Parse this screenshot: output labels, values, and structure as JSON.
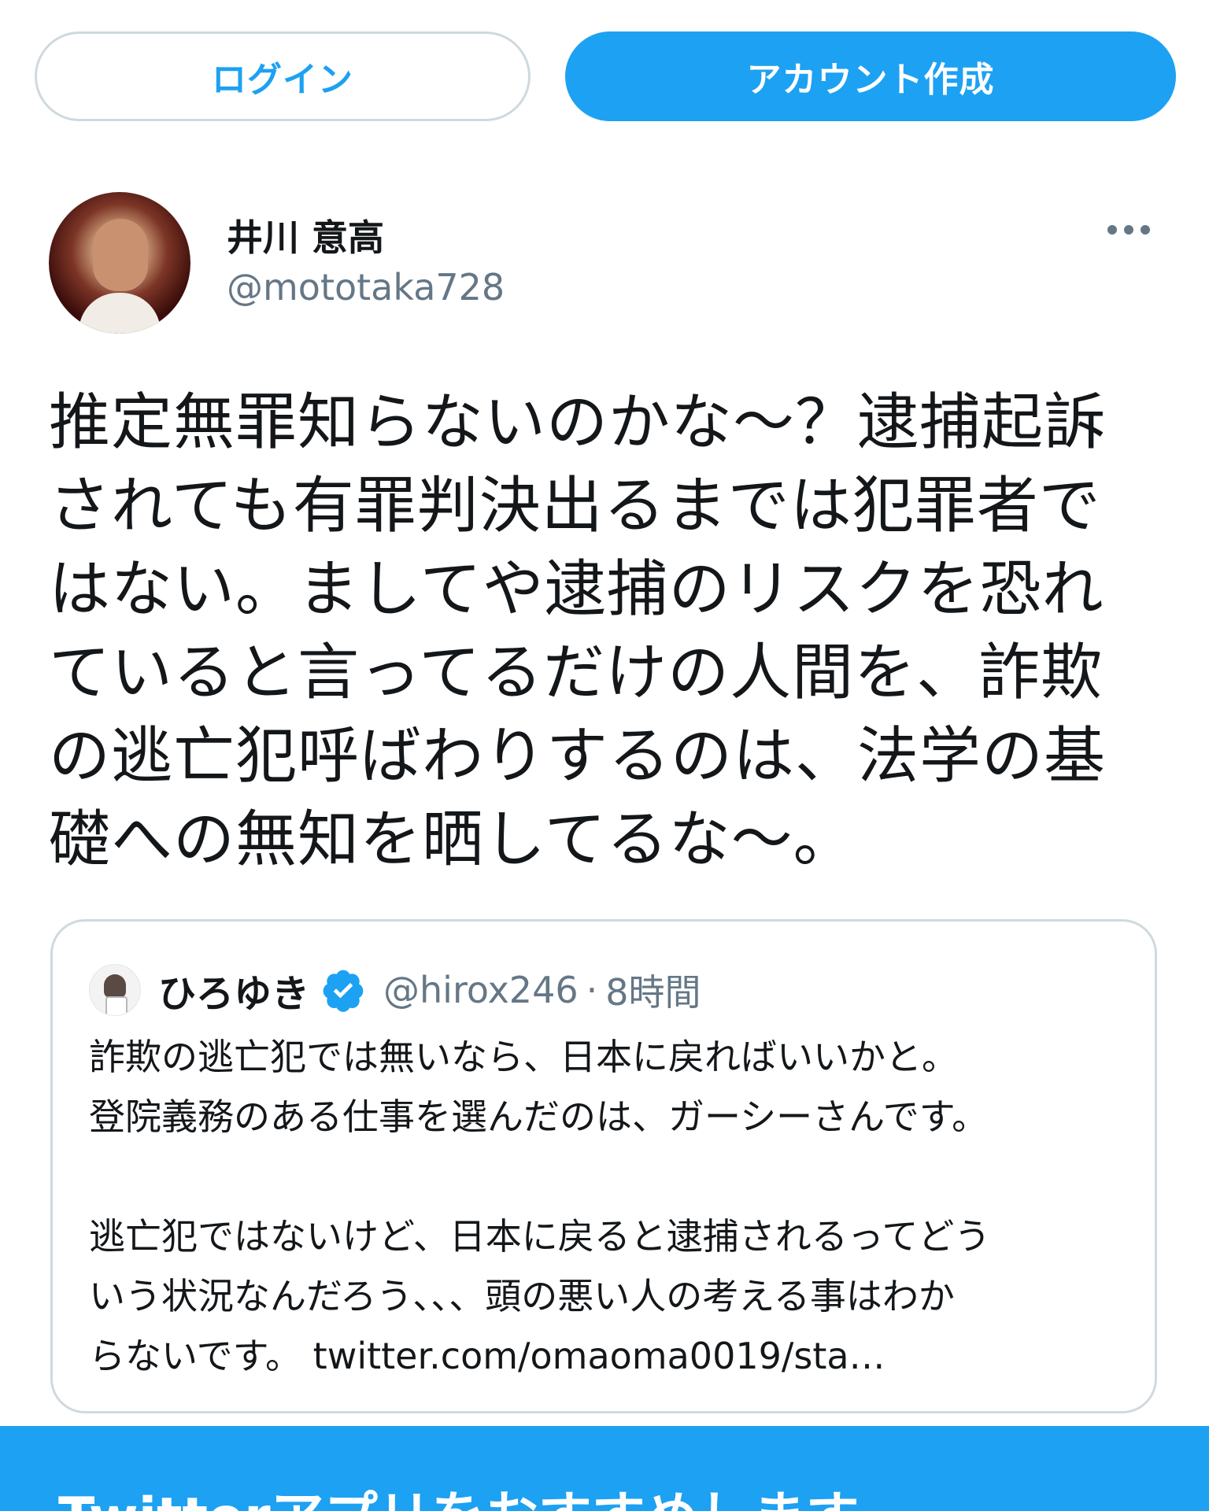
{
  "header": {
    "login_label": "ログイン",
    "signup_label": "アカウント作成"
  },
  "author": {
    "name": "井川 意高",
    "handle": "@mototaka728",
    "more_icon": "more-horizontal-icon"
  },
  "tweet": {
    "text": "推定無罪知らないのかな〜？逮捕起訴\nされても有罪判決出るまでは犯罪者で\nはない。ましてや逮捕のリスクを恐れ\nていると言ってるだけの人間を、詐欺\nの逃亡犯呼ばわりするのは、法学の基\n礎への無知を晒してるな〜。"
  },
  "quoted_tweet": {
    "name": "ひろゆき",
    "verified_icon": "verified-badge-icon",
    "handle": "@hirox246",
    "separator": "·",
    "time": "8時間",
    "text": "詐欺の逃亡犯では無いなら、日本に戻ればいいかと。\n登院義務のある仕事を選んだのは、ガーシーさんです。\n\n逃亡犯ではないけど、日本に戻ると逮捕されるってどう\nいう状況なんだろう、、、頭の悪い人の考える事はわか\nらないです。 ",
    "link": "twitter.com/omaoma0019/sta…"
  },
  "banner": {
    "text": "Twitterアプリをおすすめします"
  },
  "colors": {
    "accent": "#1da1f2",
    "border": "#cfd9de",
    "secondary_text": "#657786"
  }
}
